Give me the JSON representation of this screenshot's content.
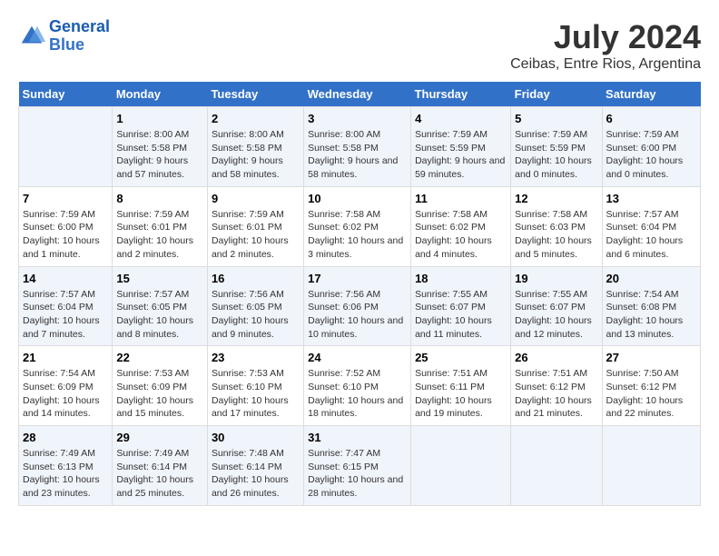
{
  "header": {
    "logo_line1": "General",
    "logo_line2": "Blue",
    "title": "July 2024",
    "subtitle": "Ceibas, Entre Rios, Argentina"
  },
  "calendar": {
    "weekdays": [
      "Sunday",
      "Monday",
      "Tuesday",
      "Wednesday",
      "Thursday",
      "Friday",
      "Saturday"
    ],
    "weeks": [
      [
        null,
        {
          "day": 1,
          "sunrise": "8:00 AM",
          "sunset": "5:58 PM",
          "daylight": "9 hours and 57 minutes."
        },
        {
          "day": 2,
          "sunrise": "8:00 AM",
          "sunset": "5:58 PM",
          "daylight": "9 hours and 58 minutes."
        },
        {
          "day": 3,
          "sunrise": "8:00 AM",
          "sunset": "5:58 PM",
          "daylight": "9 hours and 58 minutes."
        },
        {
          "day": 4,
          "sunrise": "7:59 AM",
          "sunset": "5:59 PM",
          "daylight": "9 hours and 59 minutes."
        },
        {
          "day": 5,
          "sunrise": "7:59 AM",
          "sunset": "5:59 PM",
          "daylight": "10 hours and 0 minutes."
        },
        {
          "day": 6,
          "sunrise": "7:59 AM",
          "sunset": "6:00 PM",
          "daylight": "10 hours and 0 minutes."
        }
      ],
      [
        {
          "day": 7,
          "sunrise": "7:59 AM",
          "sunset": "6:00 PM",
          "daylight": "10 hours and 1 minute."
        },
        {
          "day": 8,
          "sunrise": "7:59 AM",
          "sunset": "6:01 PM",
          "daylight": "10 hours and 2 minutes."
        },
        {
          "day": 9,
          "sunrise": "7:59 AM",
          "sunset": "6:01 PM",
          "daylight": "10 hours and 2 minutes."
        },
        {
          "day": 10,
          "sunrise": "7:58 AM",
          "sunset": "6:02 PM",
          "daylight": "10 hours and 3 minutes."
        },
        {
          "day": 11,
          "sunrise": "7:58 AM",
          "sunset": "6:02 PM",
          "daylight": "10 hours and 4 minutes."
        },
        {
          "day": 12,
          "sunrise": "7:58 AM",
          "sunset": "6:03 PM",
          "daylight": "10 hours and 5 minutes."
        },
        {
          "day": 13,
          "sunrise": "7:57 AM",
          "sunset": "6:04 PM",
          "daylight": "10 hours and 6 minutes."
        }
      ],
      [
        {
          "day": 14,
          "sunrise": "7:57 AM",
          "sunset": "6:04 PM",
          "daylight": "10 hours and 7 minutes."
        },
        {
          "day": 15,
          "sunrise": "7:57 AM",
          "sunset": "6:05 PM",
          "daylight": "10 hours and 8 minutes."
        },
        {
          "day": 16,
          "sunrise": "7:56 AM",
          "sunset": "6:05 PM",
          "daylight": "10 hours and 9 minutes."
        },
        {
          "day": 17,
          "sunrise": "7:56 AM",
          "sunset": "6:06 PM",
          "daylight": "10 hours and 10 minutes."
        },
        {
          "day": 18,
          "sunrise": "7:55 AM",
          "sunset": "6:07 PM",
          "daylight": "10 hours and 11 minutes."
        },
        {
          "day": 19,
          "sunrise": "7:55 AM",
          "sunset": "6:07 PM",
          "daylight": "10 hours and 12 minutes."
        },
        {
          "day": 20,
          "sunrise": "7:54 AM",
          "sunset": "6:08 PM",
          "daylight": "10 hours and 13 minutes."
        }
      ],
      [
        {
          "day": 21,
          "sunrise": "7:54 AM",
          "sunset": "6:09 PM",
          "daylight": "10 hours and 14 minutes."
        },
        {
          "day": 22,
          "sunrise": "7:53 AM",
          "sunset": "6:09 PM",
          "daylight": "10 hours and 15 minutes."
        },
        {
          "day": 23,
          "sunrise": "7:53 AM",
          "sunset": "6:10 PM",
          "daylight": "10 hours and 17 minutes."
        },
        {
          "day": 24,
          "sunrise": "7:52 AM",
          "sunset": "6:10 PM",
          "daylight": "10 hours and 18 minutes."
        },
        {
          "day": 25,
          "sunrise": "7:51 AM",
          "sunset": "6:11 PM",
          "daylight": "10 hours and 19 minutes."
        },
        {
          "day": 26,
          "sunrise": "7:51 AM",
          "sunset": "6:12 PM",
          "daylight": "10 hours and 21 minutes."
        },
        {
          "day": 27,
          "sunrise": "7:50 AM",
          "sunset": "6:12 PM",
          "daylight": "10 hours and 22 minutes."
        }
      ],
      [
        {
          "day": 28,
          "sunrise": "7:49 AM",
          "sunset": "6:13 PM",
          "daylight": "10 hours and 23 minutes."
        },
        {
          "day": 29,
          "sunrise": "7:49 AM",
          "sunset": "6:14 PM",
          "daylight": "10 hours and 25 minutes."
        },
        {
          "day": 30,
          "sunrise": "7:48 AM",
          "sunset": "6:14 PM",
          "daylight": "10 hours and 26 minutes."
        },
        {
          "day": 31,
          "sunrise": "7:47 AM",
          "sunset": "6:15 PM",
          "daylight": "10 hours and 28 minutes."
        },
        null,
        null,
        null
      ]
    ]
  }
}
